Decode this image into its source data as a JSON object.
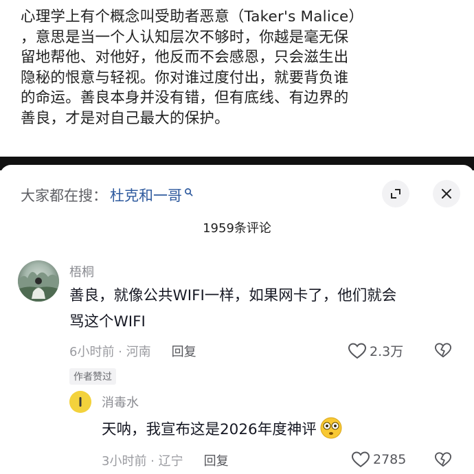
{
  "post": {
    "text": "心理学上有个概念叫受助者恶意（Taker's Malice）\n，意思是当一个人认知层次不够时，你越是毫无保\n留地帮他、对他好，他反而不会感恩，只会滋生出\n隐秘的恨意与轻视。你对谁过度付出，就要背负谁\n的命运。善良本身并没有错，但有底线、有边界的\n善良，才是对自己最大的保护。"
  },
  "search": {
    "prefix": "大家都在搜：",
    "term": "杜克和一哥"
  },
  "comment_count": "1959条评论",
  "comments": [
    {
      "author": "梧桐",
      "text": "善良，就像公共WIFI一样，如果网卡了，他们就会\n骂这个WIFI",
      "time_location": "6小时前 · 河南",
      "reply_label": "回复",
      "likes": "2.3万",
      "badge": "作者赞过"
    },
    {
      "author": "消毒水",
      "text": "天呐，我宣布这是2026年度神评",
      "time_location": "3小时前 · 辽宁",
      "reply_label": "回复",
      "likes": "2785"
    }
  ],
  "icons": {
    "search": "search-icon",
    "expand": "expand-icon",
    "close": "close-icon",
    "like": "heart-outline-icon",
    "dislike": "broken-heart-icon",
    "emoji": "flushed-face-emoji"
  },
  "colors": {
    "search_term": "#2e5a9e",
    "meta": "#9a9ba0",
    "text": "#161823",
    "band": "#111111"
  }
}
